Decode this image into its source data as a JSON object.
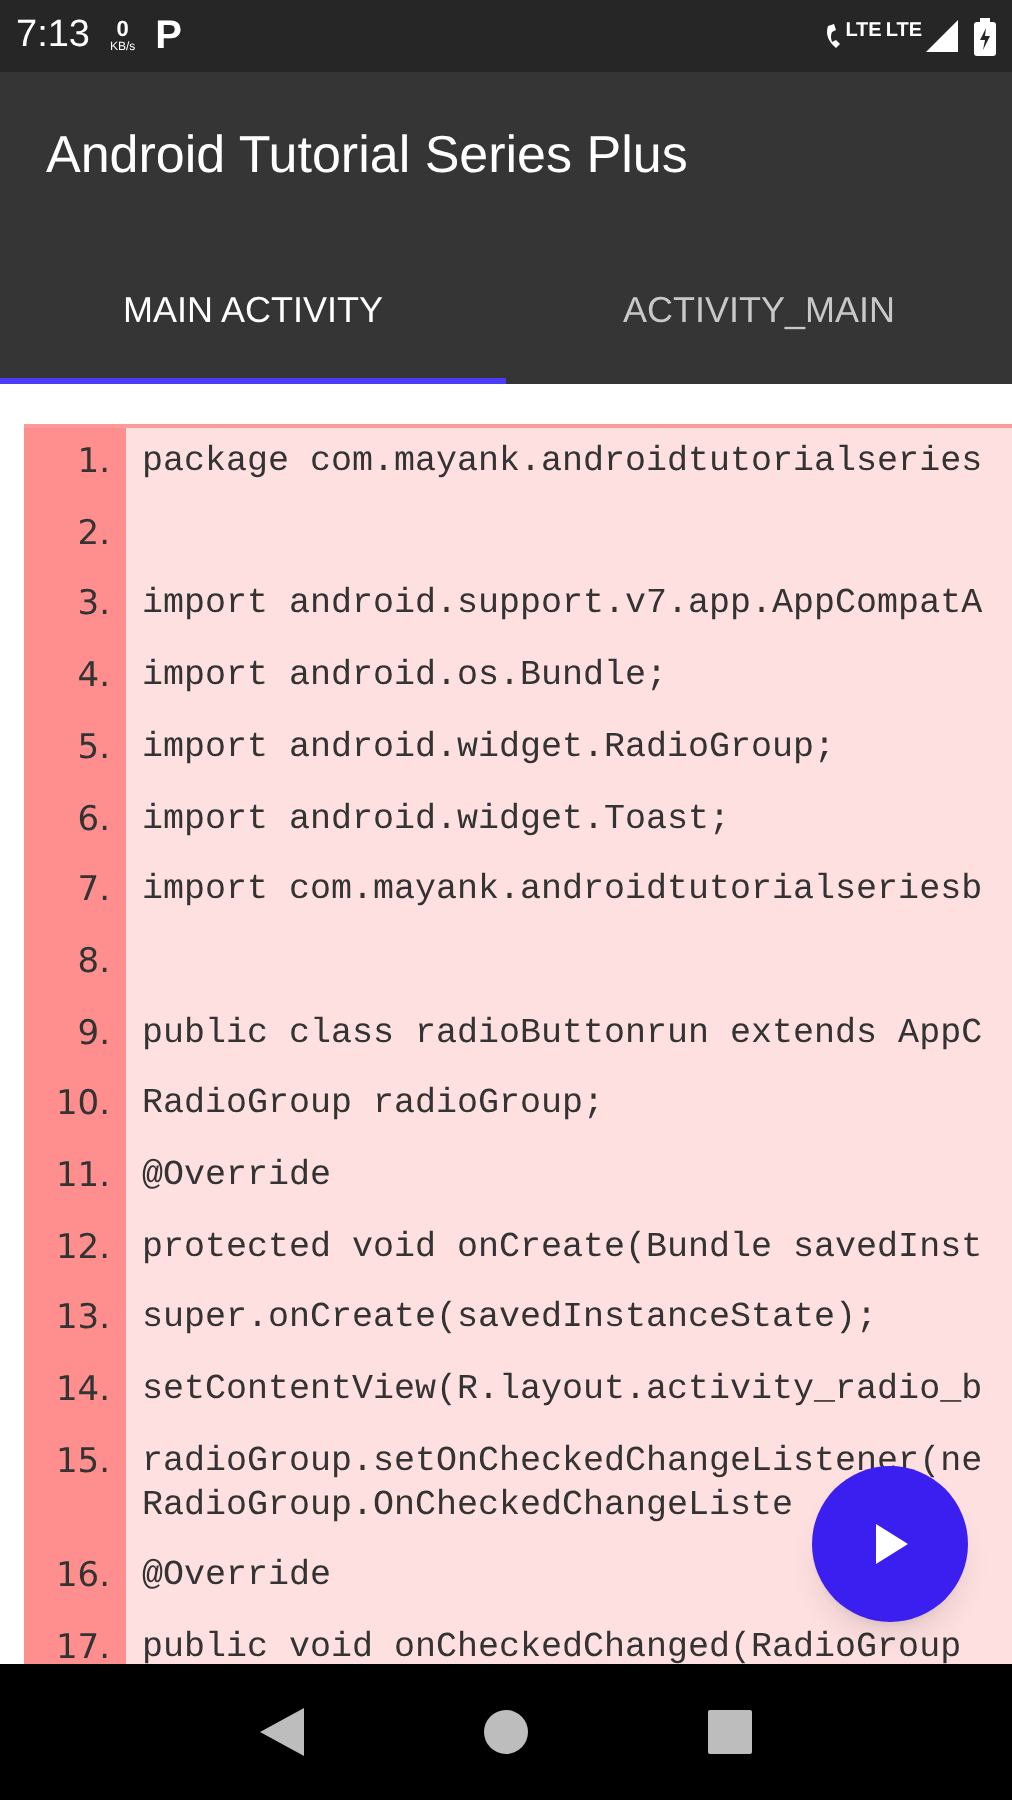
{
  "status_bar": {
    "time": "7:13",
    "speed_value": "0",
    "speed_unit": "KB/s",
    "app_glyph": "P",
    "network_labels": [
      "LTE",
      "LTE"
    ]
  },
  "app_bar": {
    "title": "Android Tutorial Series Plus"
  },
  "tabs": [
    {
      "label": "MAIN ACTIVITY",
      "selected": true
    },
    {
      "label": "ACTIVITY_MAIN",
      "selected": false
    }
  ],
  "code": {
    "lines": [
      {
        "number": "1.",
        "text": [
          "package com.mayank.androidtutorialseries"
        ]
      },
      {
        "number": "2."
      },
      {
        "number": "3.",
        "text": [
          "import android.support.v7.app.AppCompatA"
        ]
      },
      {
        "number": "4.",
        "text": [
          "import android.os.Bundle;"
        ]
      },
      {
        "number": "5.",
        "text": [
          "import android.widget.RadioGroup;"
        ]
      },
      {
        "number": "6.",
        "text": [
          "import android.widget.Toast;"
        ]
      },
      {
        "number": "7.",
        "text": [
          "import com.mayank.androidtutorialseriesb"
        ]
      },
      {
        "number": "8."
      },
      {
        "number": "9.",
        "text": [
          "public class radioButtonrun extends AppC"
        ]
      },
      {
        "number": "10.",
        "text": [
          "RadioGroup radioGroup;"
        ]
      },
      {
        "number": "11.",
        "text": [
          "@Override"
        ]
      },
      {
        "number": "12.",
        "text": [
          "protected void onCreate(Bundle savedInst"
        ]
      },
      {
        "number": "13.",
        "text": [
          "super.onCreate(savedInstanceState);"
        ]
      },
      {
        "number": "14.",
        "text": [
          "setContentView(R.layout.activity_radio_b"
        ]
      },
      {
        "number": "15.",
        "text": [
          "radioGroup.setOnCheckedChangeListener(ne",
          "RadioGroup.OnCheckedChangeListe"
        ]
      },
      {
        "number": "16.",
        "text": [
          "@Override"
        ]
      },
      {
        "number": "17.",
        "text": [
          "public void onCheckedChanged(RadioGroup"
        ]
      }
    ]
  },
  "fab": {
    "kind": "play"
  }
}
